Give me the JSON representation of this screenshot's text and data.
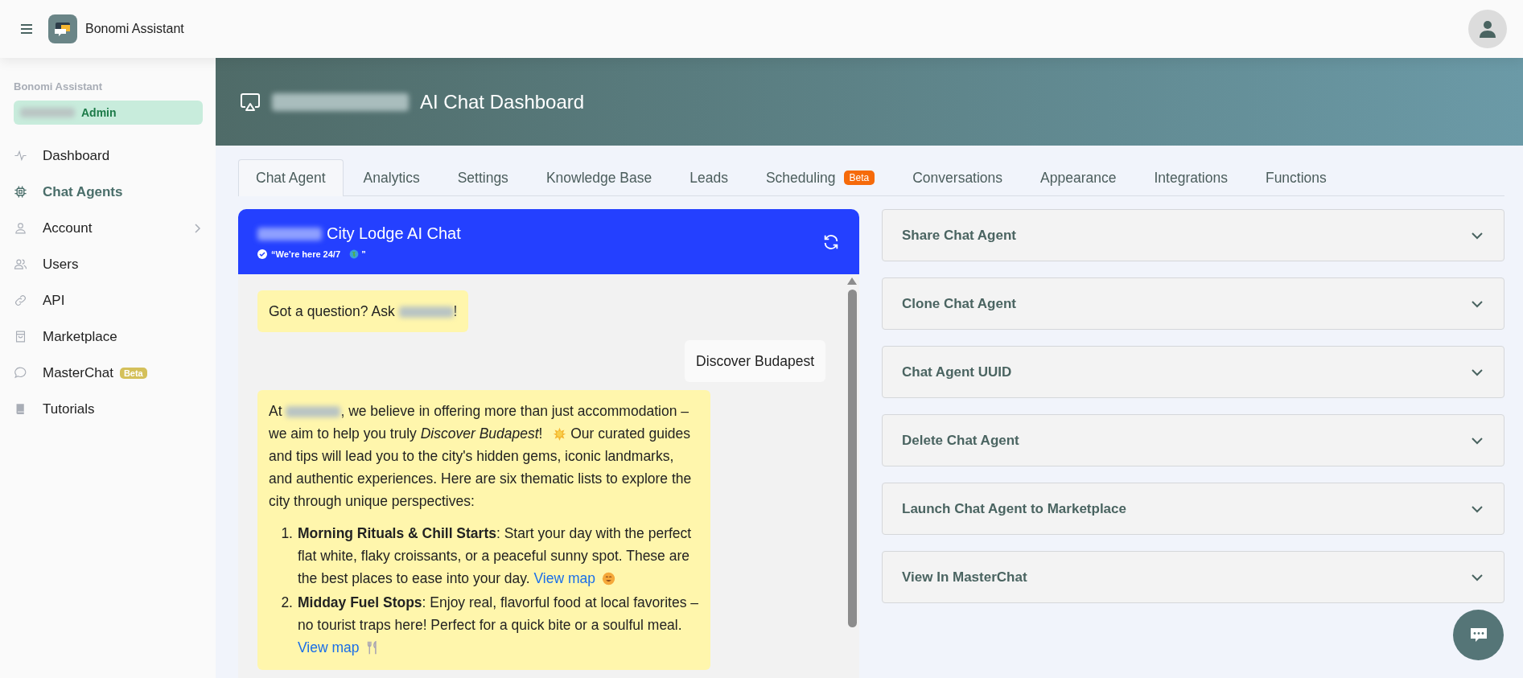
{
  "app": {
    "title": "Bonomi Assistant"
  },
  "sidebar": {
    "heading": "Bonomi Assistant",
    "role": "Admin",
    "items": [
      {
        "label": "Dashboard",
        "selected": false
      },
      {
        "label": "Chat Agents",
        "selected": true
      },
      {
        "label": "Account",
        "selected": false,
        "expandable": true
      },
      {
        "label": "Users",
        "selected": false
      },
      {
        "label": "API",
        "selected": false
      },
      {
        "label": "Marketplace",
        "selected": false
      },
      {
        "label": "MasterChat",
        "selected": false,
        "badge": "Beta"
      },
      {
        "label": "Tutorials",
        "selected": false
      }
    ]
  },
  "banner": {
    "title": "AI Chat Dashboard"
  },
  "tabs": [
    {
      "label": "Chat Agent",
      "selected": true
    },
    {
      "label": "Analytics",
      "selected": false
    },
    {
      "label": "Settings",
      "selected": false
    },
    {
      "label": "Knowledge Base",
      "selected": false
    },
    {
      "label": "Leads",
      "selected": false
    },
    {
      "label": "Scheduling",
      "selected": false,
      "badge": "Beta"
    },
    {
      "label": "Conversations",
      "selected": false
    },
    {
      "label": "Appearance",
      "selected": false
    },
    {
      "label": "Integrations",
      "selected": false
    },
    {
      "label": "Functions",
      "selected": false
    }
  ],
  "chat": {
    "title": "City Lodge AI Chat",
    "status": [
      {
        "kind": "text",
        "text": "“We’re here 24/7 "
      },
      {
        "kind": "globe"
      },
      {
        "kind": "text",
        "text": " ”"
      }
    ],
    "messages": [
      {
        "kind": "bot",
        "segments": [
          {
            "kind": "text",
            "text": "Got a question? Ask "
          },
          {
            "kind": "redacted"
          },
          {
            "kind": "text",
            "text": "!"
          }
        ]
      },
      {
        "kind": "user",
        "segments": [
          {
            "kind": "text",
            "text": "Discover Budapest"
          }
        ]
      },
      {
        "kind": "bot",
        "segments": [
          {
            "kind": "text",
            "text": "At "
          },
          {
            "kind": "redacted"
          },
          {
            "kind": "text",
            "text": ", we believe in offering more than just accommodation – we aim to help you truly *Discover Budapest*! "
          },
          {
            "kind": "sun"
          },
          {
            "kind": "text",
            "text": " Our curated guides and tips will lead you to the city's hidden gems, iconic landmarks, and authentic experiences. Here are six thematic lists to explore the city through unique perspectives:"
          }
        ],
        "list": [
          {
            "marker": "1.",
            "segments": [
              {
                "kind": "text",
                "text": "**Morning Rituals & Chill Starts**: Start your day with the perfect flat white, flaky croissants, or a peaceful sunny spot. These are the best places to ease into your day. "
              },
              {
                "kind": "link",
                "text": "View map"
              },
              {
                "kind": "smiley"
              }
            ]
          },
          {
            "marker": "2.",
            "segments": [
              {
                "kind": "text",
                "text": "**Midday Fuel Stops**: Enjoy real, flavorful food at local favorites – no tourist traps here! Perfect for a quick bite or a soulful meal. "
              },
              {
                "kind": "link",
                "text": "View map"
              },
              {
                "kind": "cutlery"
              }
            ]
          }
        ]
      }
    ]
  },
  "panels": [
    {
      "title": "Share Chat Agent",
      "expanded": false
    },
    {
      "title": "Clone Chat Agent",
      "expanded": false
    },
    {
      "title": "Chat Agent UUID",
      "expanded": false
    },
    {
      "title": "Delete Chat Agent",
      "expanded": false
    },
    {
      "title": "Launch Chat Agent to Marketplace",
      "expanded": false
    },
    {
      "title": "View In MasterChat",
      "expanded": false
    }
  ]
}
